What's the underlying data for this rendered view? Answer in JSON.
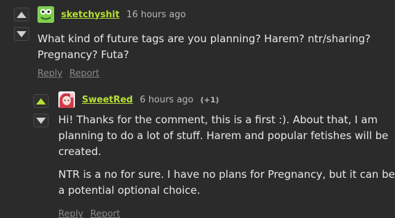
{
  "comments": [
    {
      "username": "sketchyshit",
      "time": "16 hours ago",
      "avatar_icon": "frog-avatar",
      "body": [
        "What kind of future tags are you planning? Harem? ntr/sharing? Pregnancy? Futa?"
      ],
      "actions": {
        "reply": "Reply",
        "report": "Report"
      },
      "vote_state": "none"
    },
    {
      "username": "SweetRed",
      "time": "6 hours ago",
      "score": "(+1)",
      "avatar_icon": "anime-girl-avatar",
      "body": [
        "Hi! Thanks for the comment, this is a first :). About that, I am planning to do a lot of stuff. Harem and popular fetishes will be created.",
        "NTR is a no for sure. I have no plans for Pregnancy, but it can be a potential optional choice."
      ],
      "actions": {
        "reply": "Reply",
        "report": "Report"
      },
      "vote_state": "upvoted"
    }
  ],
  "colors": {
    "background": "#2b2b2b",
    "username": "#b7e033",
    "upvote_active": "#b7e033",
    "muted_text": "#8b8b8b"
  }
}
